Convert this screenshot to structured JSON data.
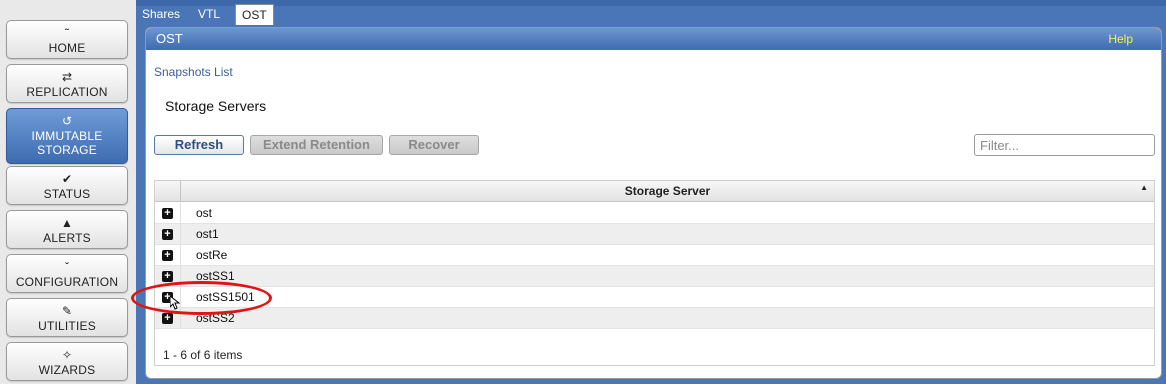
{
  "nav": {
    "items": [
      {
        "label": "HOME",
        "icon": "home-icon",
        "glyph": "˜"
      },
      {
        "label": "REPLICATION",
        "icon": "replication-icon",
        "glyph": "⇄"
      },
      {
        "label": "IMMUTABLE",
        "label2": "STORAGE",
        "icon": "immutable-storage-icon",
        "glyph": "↺"
      },
      {
        "label": "STATUS",
        "icon": "status-check-icon",
        "glyph": "✔"
      },
      {
        "label": "ALERTS",
        "icon": "bell-icon",
        "glyph": "▲"
      },
      {
        "label": "CONFIGURATION",
        "icon": "configuration-icon",
        "glyph": "ˇ"
      },
      {
        "label": "UTILITIES",
        "icon": "wrench-icon",
        "glyph": "✎"
      },
      {
        "label": "WIZARDS",
        "icon": "wand-icon",
        "glyph": "✧"
      }
    ]
  },
  "tabs": [
    "Shares",
    "VTL",
    "OST"
  ],
  "panel": {
    "title": "OST",
    "help": "Help",
    "breadcrumb": "Snapshots List",
    "section_title": "Storage Servers"
  },
  "toolbar": {
    "refresh": "Refresh",
    "extend_retention": "Extend Retention",
    "recover": "Recover",
    "filter_placeholder": "Filter..."
  },
  "grid": {
    "column": "Storage Server",
    "rows": [
      "ost",
      "ost1",
      "ostRe",
      "ostSS1",
      "ostSS1501",
      "ostSS2"
    ],
    "pager": "1 - 6 of 6 items"
  },
  "colors": {
    "accent_blue": "#4a76b8",
    "highlight_red": "#e01414",
    "help_yellow": "#ffee44"
  }
}
